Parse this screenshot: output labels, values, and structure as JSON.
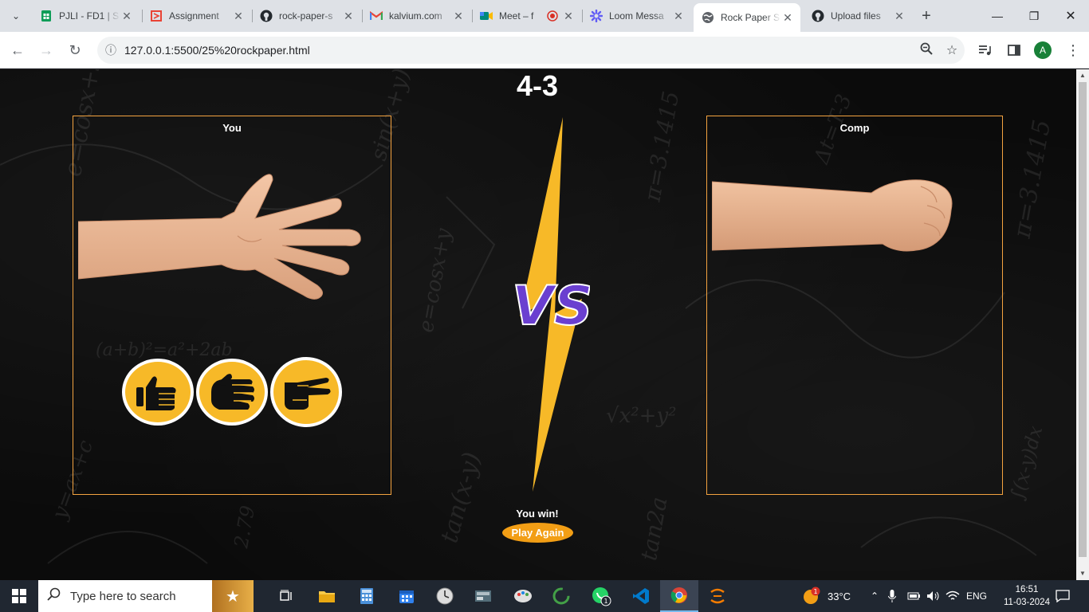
{
  "browser": {
    "tabs": [
      {
        "title": "PJLI - FD1 | S",
        "favicon": "sheets-icon",
        "color": "#0f9d58"
      },
      {
        "title": "Assignment",
        "favicon": "assignment-icon",
        "color": "#e94335"
      },
      {
        "title": "rock-paper-s",
        "favicon": "github-icon",
        "color": "#24292e"
      },
      {
        "title": "kalvium.com",
        "favicon": "gmail-icon",
        "color": "#ea4335"
      },
      {
        "title": "Meet – f",
        "favicon": "meet-icon",
        "color": "#00897b"
      },
      {
        "title": "Loom Messa",
        "favicon": "loom-icon",
        "color": "#625df5"
      },
      {
        "title": "Rock Paper S",
        "favicon": "globe-icon",
        "color": "#5f6368"
      },
      {
        "title": "Upload files",
        "favicon": "github-icon",
        "color": "#24292e"
      }
    ],
    "active_tab_index": 6,
    "url": "127.0.0.1:5500/25%20rockpaper.html",
    "avatar_letter": "A"
  },
  "game": {
    "score": "4-3",
    "player_label": "You",
    "computer_label": "Comp",
    "player_hand": "paper",
    "computer_hand": "rock",
    "choices": [
      {
        "name": "rock",
        "icon": "fist-icon"
      },
      {
        "name": "paper",
        "icon": "open-hand-icon"
      },
      {
        "name": "scissors",
        "icon": "scissors-hand-icon"
      }
    ],
    "versus_text": "VS",
    "result": "You win!",
    "play_again_label": "Play Again",
    "accent_color": "#f4a340",
    "vs_color": "#6a3fd0"
  },
  "taskbar": {
    "search_placeholder": "Type here to search",
    "temperature": "33°C",
    "language": "ENG",
    "time": "16:51",
    "date": "11-03-2024",
    "weather_badge": "1",
    "whatsapp_badge": "1"
  }
}
